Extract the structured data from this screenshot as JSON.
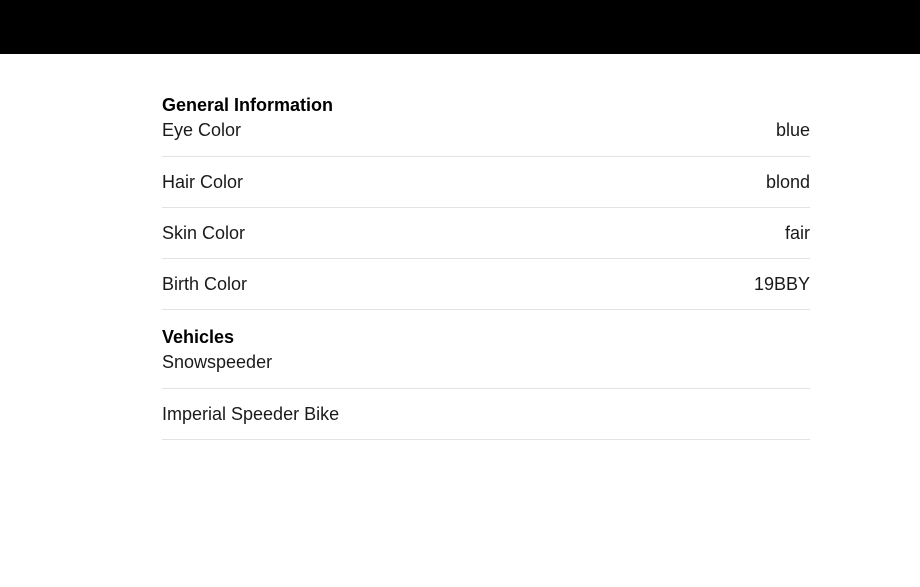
{
  "general": {
    "title": "General Information",
    "rows": [
      {
        "label": "Eye Color",
        "value": "blue"
      },
      {
        "label": "Hair Color",
        "value": "blond"
      },
      {
        "label": "Skin Color",
        "value": "fair"
      },
      {
        "label": "Birth Color",
        "value": "19BBY"
      }
    ]
  },
  "vehicles": {
    "title": "Vehicles",
    "items": [
      "Snowspeeder",
      "Imperial Speeder Bike"
    ]
  }
}
